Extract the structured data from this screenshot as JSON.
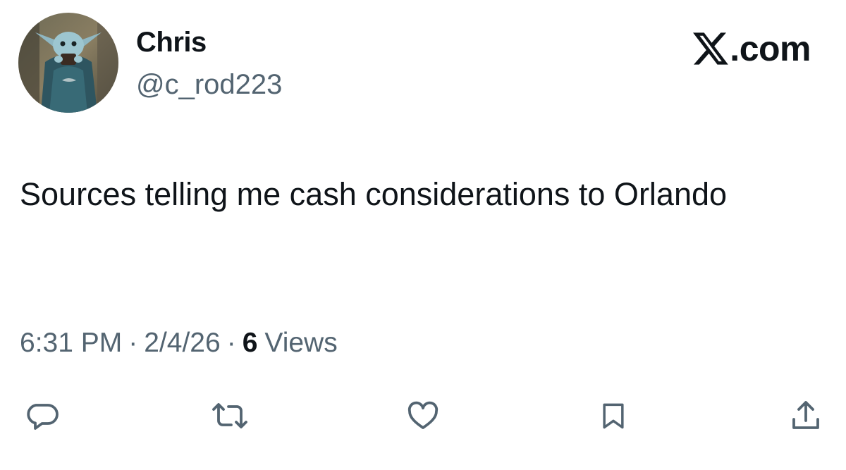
{
  "author": {
    "display_name": "Chris",
    "handle": "@c_rod223",
    "avatar_icon": "avatar-image"
  },
  "brand": {
    "label": ".com",
    "logo_icon": "x-logo-icon"
  },
  "tweet": {
    "text": "Sources telling me cash considerations to Orlando"
  },
  "meta": {
    "time": "6:31 PM",
    "separator": "·",
    "date": "2/4/26",
    "views_count": "6",
    "views_label": "Views"
  },
  "actions": [
    {
      "icon": "reply-icon"
    },
    {
      "icon": "retweet-icon"
    },
    {
      "icon": "like-icon"
    },
    {
      "icon": "bookmark-icon"
    },
    {
      "icon": "share-icon"
    }
  ],
  "colors": {
    "text_primary": "#0f1419",
    "text_secondary": "#536471",
    "icon": "#536471"
  }
}
